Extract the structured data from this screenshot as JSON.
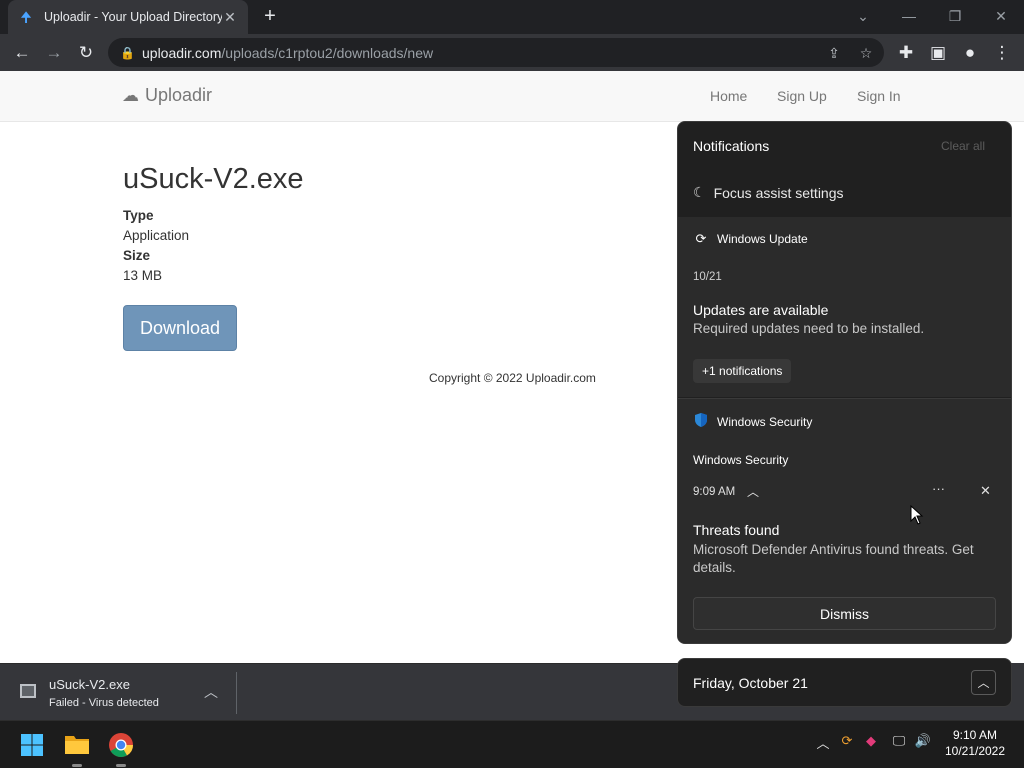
{
  "browser": {
    "tab_title": "Uploadir - Your Upload Directory",
    "url_host": "uploadir.com",
    "url_path": "/uploads/c1rptou2/downloads/new"
  },
  "site": {
    "brand": "Uploadir",
    "nav": [
      "Home",
      "Sign Up",
      "Sign In"
    ],
    "file_name": "uSuck-V2.exe",
    "type_label": "Type",
    "type_value": "Application",
    "size_label": "Size",
    "size_value": "13 MB",
    "download_label": "Download",
    "copyright": "Copyright © 2022 Uploadir.com"
  },
  "notifications": {
    "title": "Notifications",
    "clear_all": "Clear all",
    "focus_assist": "Focus assist settings",
    "update": {
      "app": "Windows Update",
      "date": "10/21",
      "heading": "Updates are available",
      "body": "Required updates need to be installed.",
      "more": "+1 notifications"
    },
    "security": {
      "app": "Windows Security",
      "sender": "Windows Security",
      "time": "9:09 AM",
      "heading": "Threats found",
      "body": "Microsoft Defender Antivirus found threats. Get details.",
      "dismiss": "Dismiss"
    }
  },
  "calendar": {
    "date": "Friday, October 21"
  },
  "download_bar": {
    "file": "uSuck-V2.exe",
    "status": "Failed - Virus detected"
  },
  "taskbar": {
    "time": "9:10 AM",
    "date": "10/21/2022"
  }
}
